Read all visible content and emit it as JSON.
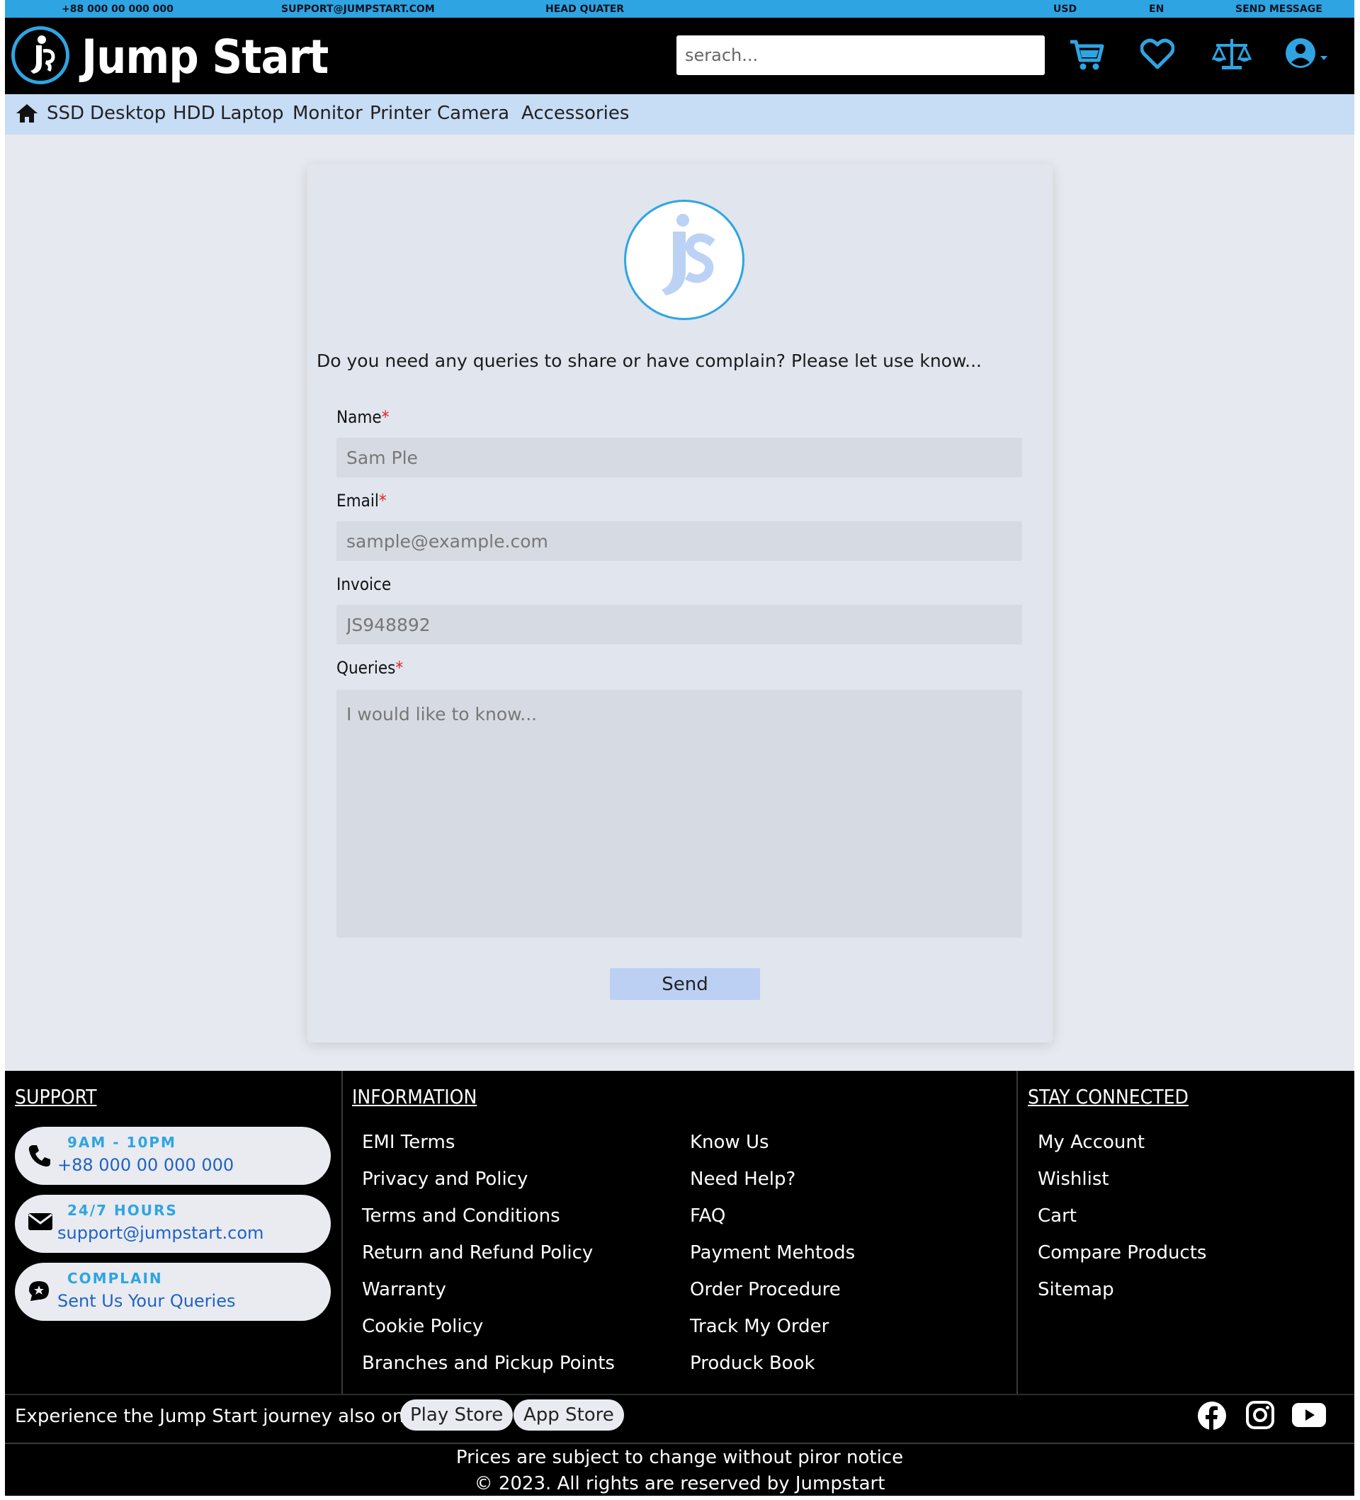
{
  "topbar": {
    "phone": "+88 000 00 000 000",
    "email": "SUPPORT@JUMPSTART.COM",
    "hq": "HEAD QUATER",
    "currency": "USD",
    "language": "EN",
    "send_message": "SEND MESSAGE"
  },
  "header": {
    "brand": "Jump Start",
    "search_placeholder": "serach...",
    "icons": [
      "cart-icon",
      "heart-icon",
      "compare-scale-icon",
      "user-account-icon"
    ]
  },
  "categories": [
    "SSD",
    "Desktop",
    "HDD",
    "Laptop",
    "Monitor",
    "Printer",
    "Camera",
    "Accessories"
  ],
  "form": {
    "intro": "Do you need any queries to share or have complain? Please let use know...",
    "name_label": "Name",
    "name_placeholder": "Sam Ple",
    "email_label": "Email",
    "email_placeholder": "sample@example.com",
    "invoice_label": "Invoice",
    "invoice_placeholder": "JS948892",
    "queries_label": "Queries",
    "queries_placeholder": "I would like to know...",
    "required_mark": "*",
    "send_label": "Send"
  },
  "footer": {
    "support": {
      "heading": "SUPPORT",
      "items": [
        {
          "title": "9AM - 10PM",
          "sub": "+88 000 00 000 000",
          "icon": "phone-icon"
        },
        {
          "title": "24/7 HOURS",
          "sub": "support@jumpstart.com",
          "icon": "mail-icon"
        },
        {
          "title": "COMPLAIN",
          "sub": "Sent Us Your Queries",
          "icon": "complain-icon"
        }
      ]
    },
    "information": {
      "heading": "INFORMATION",
      "col1": [
        "EMI Terms",
        "Privacy and Policy",
        "Terms and Conditions",
        "Return and Refund Policy",
        "Warranty",
        "Cookie Policy",
        "Branches and Pickup Points"
      ],
      "col2": [
        "Know Us",
        "Need Help?",
        "FAQ",
        "Payment Mehtods",
        "Order Procedure",
        "Track My Order",
        "Produck Book"
      ]
    },
    "stay_connected": {
      "heading": "STAY CONNECTED",
      "links": [
        "My Account",
        "Wishlist",
        "Cart",
        "Compare Products",
        "Sitemap"
      ]
    },
    "app_text": "Experience the Jump Start journey also on",
    "play_store": "Play Store",
    "app_store": "App Store",
    "social_icons": [
      "facebook-icon",
      "instagram-icon",
      "youtube-icon"
    ],
    "notice": "Prices are subject to change without piror notice",
    "copyright": "© 2023. All rights are reserved by Jumpstart"
  },
  "colors": {
    "accent": "#2fa4e2",
    "nav_bg": "#c7dcf5",
    "page_bg": "#e6e9ef",
    "button_bg": "#bcd0f3",
    "required": "#e02424"
  }
}
